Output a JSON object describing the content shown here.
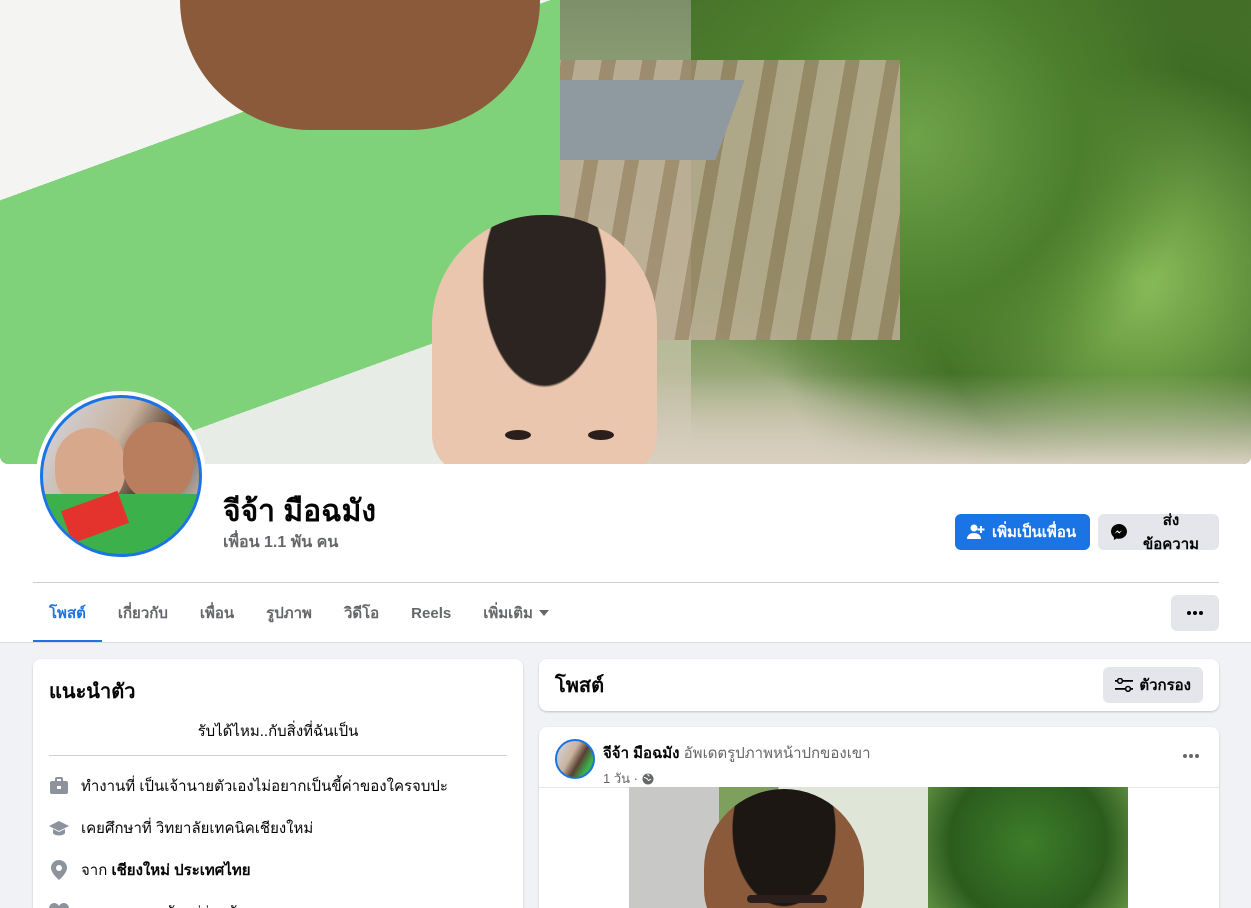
{
  "profile": {
    "name": "จีจ้า มือฉมัง",
    "friends_count": "เพื่อน 1.1 พัน คน"
  },
  "actions": {
    "add_friend": "เพิ่มเป็นเพื่อน",
    "message": "ส่งข้อความ"
  },
  "tabs": [
    {
      "label": "โพสต์",
      "active": true
    },
    {
      "label": "เกี่ยวกับ",
      "active": false
    },
    {
      "label": "เพื่อน",
      "active": false
    },
    {
      "label": "รูปภาพ",
      "active": false
    },
    {
      "label": "วิดีโอ",
      "active": false
    },
    {
      "label": "Reels",
      "active": false
    },
    {
      "label": "เพิ่มเติม",
      "active": false
    }
  ],
  "intro": {
    "title": "แนะนำตัว",
    "bio": "รับได้ไหม..กับสิ่งที่ฉันเป็น",
    "work": "ทำงานที่ เป็นเจ้านายตัวเองไม่อยากเป็นขี้ค่าของใครจบปะ",
    "education": "เคยศึกษาที่ วิทยาลัยเทคนิคเชียงใหม่",
    "from_prefix": "จาก",
    "from_place": "เชียงใหม่ ประเทศไทย",
    "relationship": "คบหาแบบอาศัยอยู่ร่วมกัน"
  },
  "posts_header": {
    "title": "โพสต์",
    "filter_label": "ตัวกรอง"
  },
  "post": {
    "author": "จีจ้า มือฉมัง",
    "action": "อัพเดตรูปภาพหน้าปกของเขา",
    "time": "1 วัน ·"
  },
  "colors": {
    "accent": "#1b74e4",
    "secondary_button": "#e4e6eb",
    "muted_text": "#65676b",
    "page_background": "#f0f2f5"
  },
  "icons": {
    "add_friend": "person-plus-icon",
    "message": "messenger-icon",
    "more": "more-dots-icon",
    "dropdown": "caret-down-icon",
    "filter": "filter-sliders-icon",
    "work": "briefcase-icon",
    "education": "graduation-cap-icon",
    "location": "location-pin-icon",
    "relationship": "heart-icon",
    "audience": "globe-icon"
  }
}
